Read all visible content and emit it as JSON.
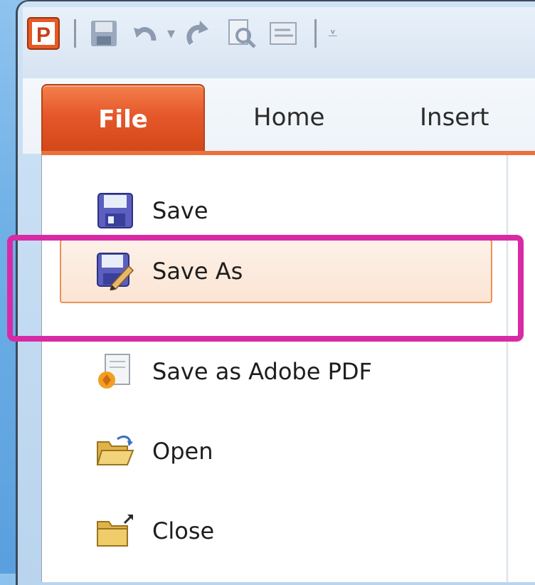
{
  "ribbon": {
    "tabs": [
      "File",
      "Home",
      "Insert"
    ]
  },
  "qat": {
    "app_icon_letter": "P"
  },
  "file_menu": {
    "items": [
      {
        "label": "Save",
        "icon": "save-icon"
      },
      {
        "label": "Save As",
        "icon": "save-as-icon"
      },
      {
        "label": "Save as Adobe PDF",
        "icon": "adobe-pdf-icon"
      },
      {
        "label": "Open",
        "icon": "open-folder-icon"
      },
      {
        "label": "Close",
        "icon": "close-folder-icon"
      }
    ],
    "selected_index": 1
  },
  "colors": {
    "file_tab": "#e5572a",
    "annotation_highlight": "#d92aa5",
    "hover_border": "#e8935a"
  }
}
